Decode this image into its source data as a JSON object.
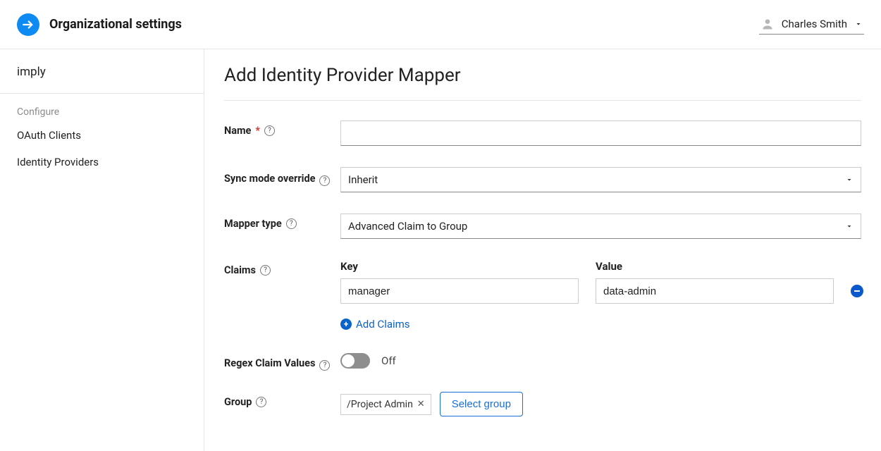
{
  "header": {
    "title": "Organizational settings",
    "user_name": "Charles Smith"
  },
  "sidebar": {
    "header": "imply",
    "section_label": "Configure",
    "items": [
      {
        "label": "OAuth Clients"
      },
      {
        "label": "Identity Providers"
      }
    ]
  },
  "main": {
    "heading": "Add Identity Provider Mapper",
    "labels": {
      "name": "Name",
      "sync_mode": "Sync mode override",
      "mapper_type": "Mapper type",
      "claims": "Claims",
      "regex": "Regex Claim Values",
      "group": "Group"
    },
    "name_value": "",
    "sync_mode_value": "Inherit",
    "mapper_type_value": "Advanced Claim to Group",
    "claims_headers": {
      "key": "Key",
      "value": "Value"
    },
    "claims": [
      {
        "key": "manager",
        "value": "data-admin"
      }
    ],
    "add_claims_label": "Add Claims",
    "regex_state_label": "Off",
    "group_chip": "/Project Admin",
    "select_group_label": "Select group"
  }
}
